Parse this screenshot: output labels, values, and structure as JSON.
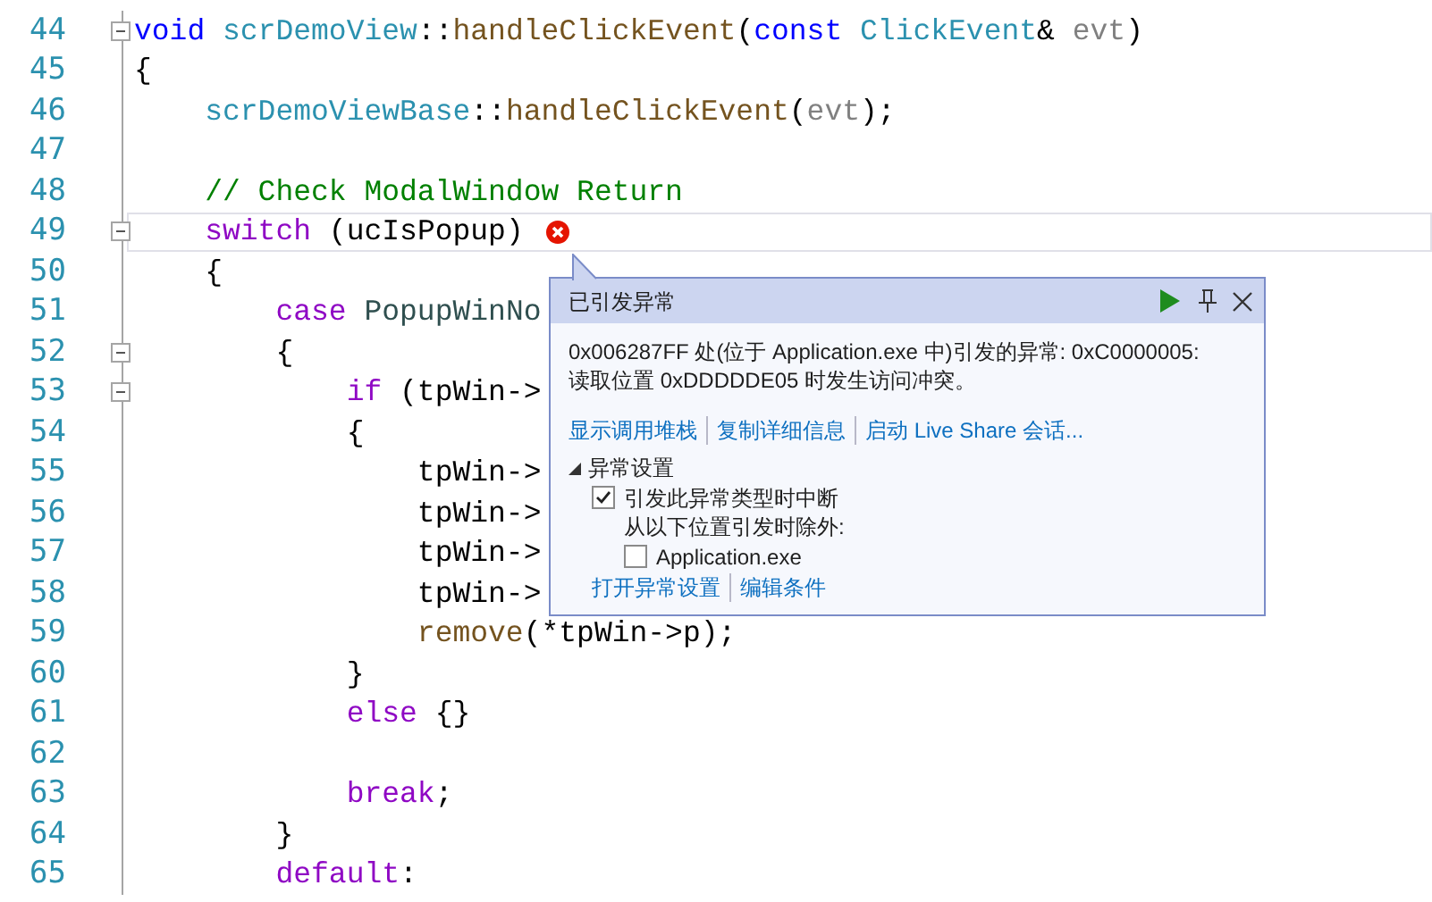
{
  "editor": {
    "lines": [
      {
        "number": "44",
        "fold": true,
        "tokens": [
          {
            "kind": "keyword",
            "text": "void "
          },
          {
            "kind": "type",
            "text": "scrDemoView"
          },
          {
            "kind": "plain",
            "text": "::"
          },
          {
            "kind": "function",
            "text": "handleClickEvent"
          },
          {
            "kind": "plain",
            "text": "("
          },
          {
            "kind": "keyword",
            "text": "const "
          },
          {
            "kind": "type",
            "text": "ClickEvent"
          },
          {
            "kind": "plain",
            "text": "& "
          },
          {
            "kind": "param",
            "text": "evt"
          },
          {
            "kind": "plain",
            "text": ")"
          }
        ]
      },
      {
        "number": "45",
        "tokens": [
          {
            "kind": "plain",
            "text": "{"
          }
        ]
      },
      {
        "number": "46",
        "tokens": [
          {
            "kind": "type",
            "text": "    scrDemoViewBase"
          },
          {
            "kind": "plain",
            "text": "::"
          },
          {
            "kind": "function",
            "text": "handleClickEvent"
          },
          {
            "kind": "plain",
            "text": "("
          },
          {
            "kind": "param",
            "text": "evt"
          },
          {
            "kind": "plain",
            "text": ");"
          }
        ]
      },
      {
        "number": "47"
      },
      {
        "number": "48",
        "tokens": [
          {
            "kind": "comment",
            "text": "    // Check ModalWindow Return"
          }
        ]
      },
      {
        "number": "49",
        "fold": true,
        "current": true,
        "error": true,
        "tokens": [
          {
            "kind": "control",
            "text": "    switch"
          },
          {
            "kind": "plain",
            "text": " (ucIsPopup)"
          }
        ]
      },
      {
        "number": "50",
        "tokens": [
          {
            "kind": "plain",
            "text": "    {"
          }
        ]
      },
      {
        "number": "51",
        "tokens": [
          {
            "kind": "control",
            "text": "        case"
          },
          {
            "kind": "enum",
            "text": " PopupWinNo"
          }
        ]
      },
      {
        "number": "52",
        "fold": true,
        "tokens": [
          {
            "kind": "plain",
            "text": "        {"
          }
        ]
      },
      {
        "number": "53",
        "fold": true,
        "tokens": [
          {
            "kind": "control",
            "text": "            if"
          },
          {
            "kind": "plain",
            "text": " (tpWin->"
          }
        ]
      },
      {
        "number": "54",
        "tokens": [
          {
            "kind": "plain",
            "text": "            {"
          }
        ]
      },
      {
        "number": "55",
        "tokens": [
          {
            "kind": "plain",
            "text": "                tpWin->"
          }
        ]
      },
      {
        "number": "56",
        "tokens": [
          {
            "kind": "plain",
            "text": "                tpWin->"
          }
        ]
      },
      {
        "number": "57",
        "tokens": [
          {
            "kind": "plain",
            "text": "                tpWin->"
          }
        ]
      },
      {
        "number": "58",
        "tokens": [
          {
            "kind": "plain",
            "text": "                tpWin->"
          }
        ]
      },
      {
        "number": "59",
        "tokens": [
          {
            "kind": "function",
            "text": "                remove"
          },
          {
            "kind": "plain",
            "text": "(*tpWin->p);"
          }
        ]
      },
      {
        "number": "60",
        "tokens": [
          {
            "kind": "plain",
            "text": "            }"
          }
        ]
      },
      {
        "number": "61",
        "tokens": [
          {
            "kind": "control",
            "text": "            else"
          },
          {
            "kind": "plain",
            "text": " {}"
          }
        ]
      },
      {
        "number": "62"
      },
      {
        "number": "63",
        "tokens": [
          {
            "kind": "control",
            "text": "            break"
          },
          {
            "kind": "plain",
            "text": ";"
          }
        ]
      },
      {
        "number": "64",
        "tokens": [
          {
            "kind": "plain",
            "text": "        }"
          }
        ]
      },
      {
        "number": "65",
        "tokens": [
          {
            "kind": "control",
            "text": "        default"
          },
          {
            "kind": "plain",
            "text": ":"
          }
        ]
      }
    ]
  },
  "exception_popup": {
    "title": "已引发异常",
    "message_lines": [
      "0x006287FF 处(位于 Application.exe 中)引发的异常: 0xC0000005:",
      "读取位置 0xDDDDDE05 时发生访问冲突。"
    ],
    "links": [
      "显示调用堆栈",
      "复制详细信息",
      "启动 Live Share 会话..."
    ],
    "settings": {
      "title": "异常设置",
      "expanded": true,
      "break_option": {
        "label": "引发此异常类型时中断",
        "checked": true
      },
      "except_label": "从以下位置引发时除外:",
      "exceptions": [
        {
          "label": "Application.exe",
          "checked": false
        }
      ],
      "links": [
        "打开异常设置",
        "编辑条件"
      ]
    }
  }
}
